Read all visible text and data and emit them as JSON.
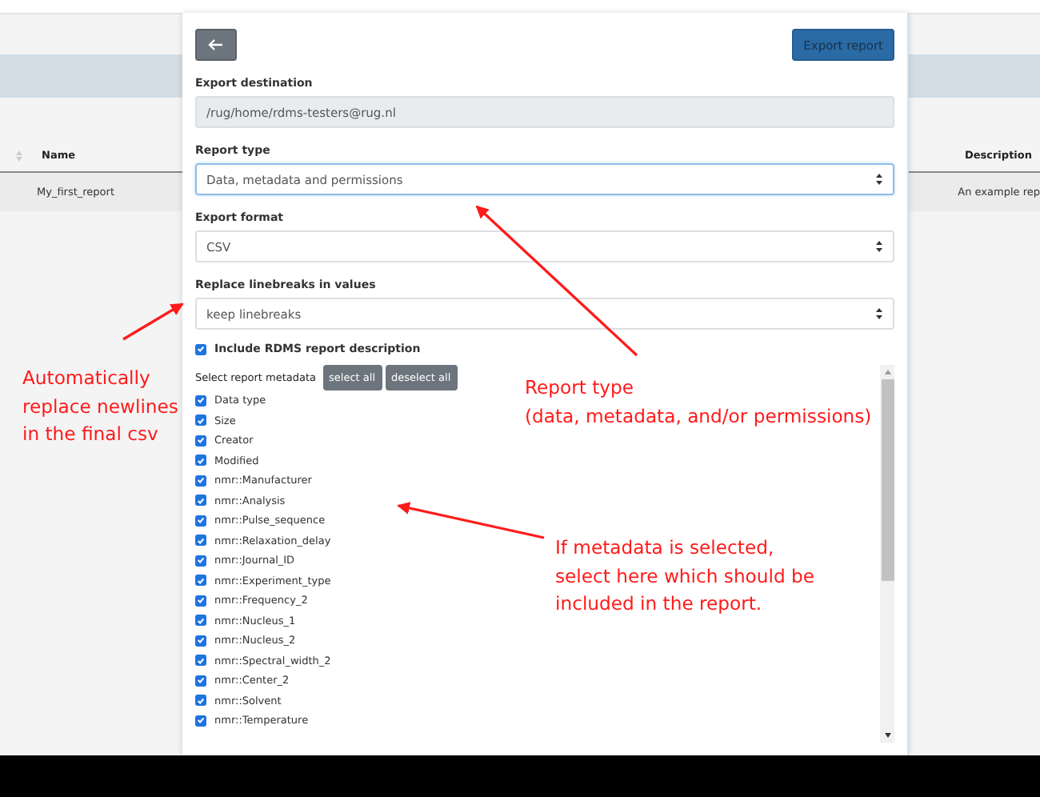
{
  "background_table": {
    "columns": [
      "Name",
      "Description"
    ],
    "rows": [
      [
        "My_first_report",
        "An example rep"
      ]
    ]
  },
  "modal": {
    "export_button": "Export report",
    "fields": [
      {
        "label": "Export destination",
        "kind": "readonly",
        "value": "/rug/home/rdms-testers@rug.nl",
        "focused": false
      },
      {
        "label": "Report type",
        "kind": "select",
        "value": "Data, metadata and permissions",
        "focused": true
      },
      {
        "label": "Export format",
        "kind": "select",
        "value": "CSV",
        "focused": false
      },
      {
        "label": "Replace linebreaks in values",
        "kind": "select",
        "value": "keep linebreaks",
        "focused": false
      }
    ],
    "include_description": {
      "label": "Include RDMS report description",
      "checked": true
    },
    "metadata": {
      "label": "Select report metadata",
      "buttons": [
        "select all",
        "deselect all"
      ],
      "items": [
        {
          "label": "Data type",
          "checked": true
        },
        {
          "label": "Size",
          "checked": true
        },
        {
          "label": "Creator",
          "checked": true
        },
        {
          "label": "Modified",
          "checked": true
        },
        {
          "label": "nmr::Manufacturer",
          "checked": true
        },
        {
          "label": "nmr::Analysis",
          "checked": true
        },
        {
          "label": "nmr::Pulse_sequence",
          "checked": true
        },
        {
          "label": "nmr::Relaxation_delay",
          "checked": true
        },
        {
          "label": "nmr::Journal_ID",
          "checked": true
        },
        {
          "label": "nmr::Experiment_type",
          "checked": true
        },
        {
          "label": "nmr::Frequency_2",
          "checked": true
        },
        {
          "label": "nmr::Nucleus_1",
          "checked": true
        },
        {
          "label": "nmr::Nucleus_2",
          "checked": true
        },
        {
          "label": "nmr::Spectral_width_2",
          "checked": true
        },
        {
          "label": "nmr::Center_2",
          "checked": true
        },
        {
          "label": "nmr::Solvent",
          "checked": true
        },
        {
          "label": "nmr::Temperature",
          "checked": true
        }
      ]
    }
  },
  "annotations": [
    {
      "lines": [
        "Automatically",
        "replace newlines",
        "in the final csv"
      ]
    },
    {
      "lines": [
        "Report type",
        "(data, metadata, and/or permissions)"
      ]
    },
    {
      "lines": [
        "If metadata is selected,",
        "select here which should be",
        "included in the report."
      ]
    }
  ]
}
